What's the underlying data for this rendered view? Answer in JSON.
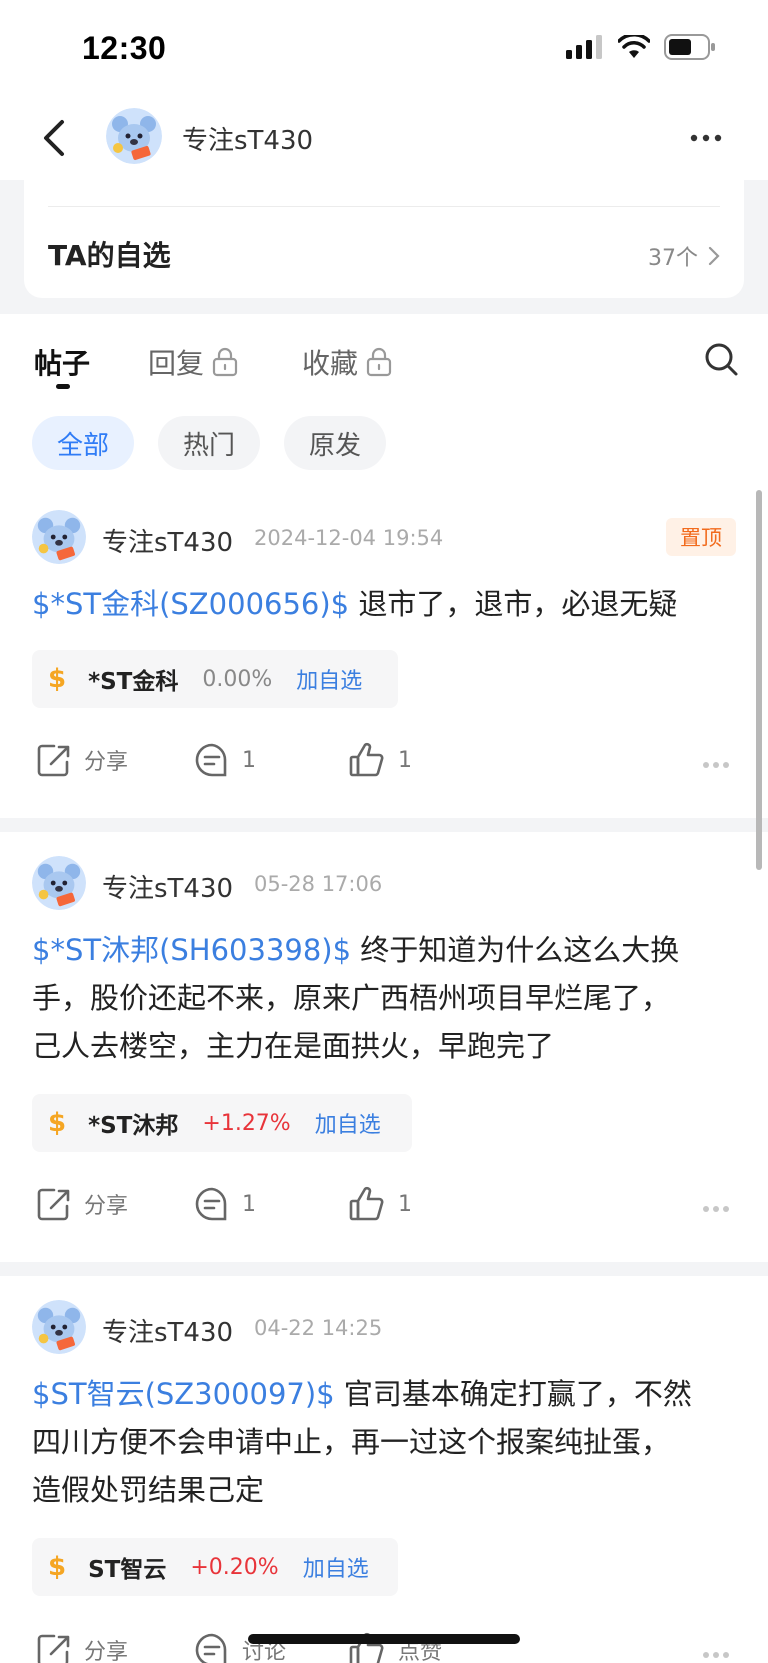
{
  "status_bar": {
    "time": "12:30"
  },
  "header": {
    "username": "专注sT430"
  },
  "watchlist": {
    "title": "TA的自选",
    "count": "37个"
  },
  "tabs": [
    {
      "label": "帖子",
      "locked": false,
      "active": true
    },
    {
      "label": "回复",
      "locked": true,
      "active": false
    },
    {
      "label": "收藏",
      "locked": true,
      "active": false
    }
  ],
  "filters": [
    {
      "label": "全部",
      "active": true
    },
    {
      "label": "热门",
      "active": false
    },
    {
      "label": "原发",
      "active": false
    }
  ],
  "posts": [
    {
      "author": "专注sT430",
      "time": "2024-12-04 19:54",
      "pinned_label": "置顶",
      "stock_link": "$*ST金科(SZ000656)$",
      "text_line1": " 退市了，退市，必退无疑",
      "text_line2": "",
      "text_line3": "",
      "stock": {
        "name": "*ST金科",
        "change": "0.00%",
        "add": "加自选"
      },
      "actions": {
        "share": "分享",
        "comments": "1",
        "likes": "1"
      }
    },
    {
      "author": "专注sT430",
      "time": "05-28 17:06",
      "stock_link": "$*ST沐邦(SH603398)$",
      "text_line1": " 终于知道为什么这么大换",
      "text_line2": "手，股价还起不来，原来广西梧州项目早烂尾了，",
      "text_line3": "己人去楼空，主力在是面拱火，早跑完了",
      "stock": {
        "name": "*ST沐邦",
        "change": "+1.27%",
        "add": "加自选"
      },
      "actions": {
        "share": "分享",
        "comments": "1",
        "likes": "1"
      }
    },
    {
      "author": "专注sT430",
      "time": "04-22 14:25",
      "stock_link": "$ST智云(SZ300097)$",
      "text_line1": " 官司基本确定打赢了，不然",
      "text_line2": "四川方便不会申请中止，再一过这个报案纯扯蛋，",
      "text_line3": "造假处罚结果己定",
      "stock": {
        "name": "ST智云",
        "change": "+0.20%",
        "add": "加自选"
      },
      "actions": {
        "share": "分享",
        "comment_label": "讨论",
        "like_label": "点赞"
      }
    }
  ],
  "colors": {
    "accent": "#2f7cf6",
    "link": "#3b7fe0",
    "up": "#e8343a",
    "pin": "#f26b1d",
    "dollar": "#f5a623"
  }
}
